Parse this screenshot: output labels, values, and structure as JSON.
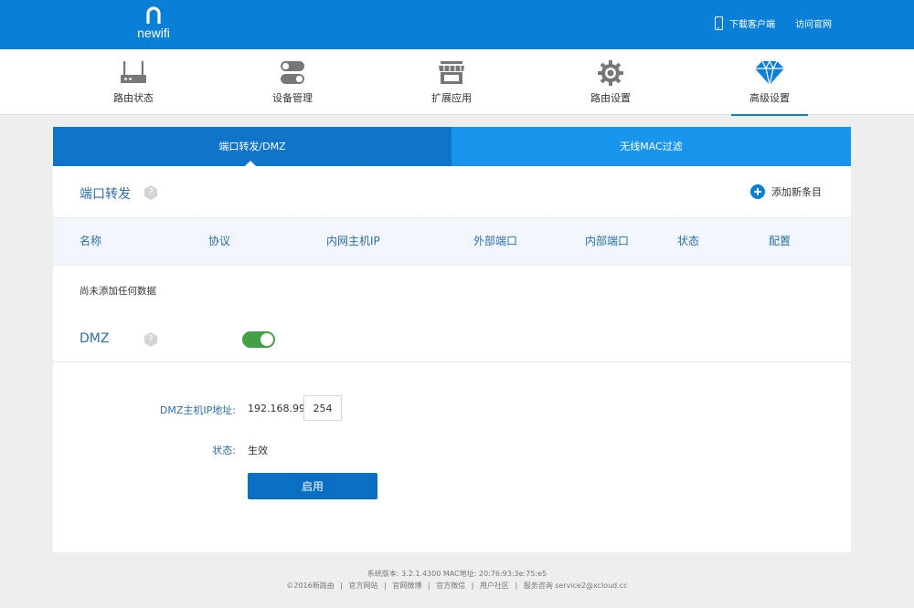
{
  "header": {
    "brand": "newifi",
    "links": [
      "下载客户端",
      "访问官网"
    ]
  },
  "nav": {
    "items": [
      {
        "label": "路由状态",
        "icon": "router-icon"
      },
      {
        "label": "设备管理",
        "icon": "toggle-switches-icon"
      },
      {
        "label": "扩展应用",
        "icon": "store-icon"
      },
      {
        "label": "路由设置",
        "icon": "gear-icon"
      },
      {
        "label": "高级设置",
        "icon": "diamond-icon"
      }
    ],
    "active_index": 4
  },
  "tabs": [
    "端口转发/DMZ",
    "无线MAC过滤"
  ],
  "port_forward": {
    "title": "端口转发",
    "help": "?",
    "add_label": "添加新条目",
    "columns": [
      "名称",
      "协议",
      "内网主机IP",
      "外部端口",
      "内部端口",
      "状态",
      "配置"
    ],
    "empty_text": "尚未添加任何数据"
  },
  "dmz": {
    "title": "DMZ",
    "help": "?",
    "enabled": true,
    "host_ip_label": "DMZ主机IP地址:",
    "ip_prefix": "192.168.99.",
    "ip_last": "254",
    "status_label": "状态:",
    "status_value": "生效",
    "button_label": "启用"
  },
  "footer": {
    "version_line": "系统版本:   3.2.1.4300    MAC地址:   20:76:93:3e:75:e5",
    "links": [
      "©2016新路由",
      "|",
      "官方网站",
      "|",
      "官网微博",
      "|",
      "官方微信",
      "|",
      "用户社区",
      "|",
      "服务咨询 service2@xcloud.cc"
    ]
  },
  "colors": {
    "brand_blue": "#0a7fd8",
    "tab_active": "#0d74c8",
    "tab_inactive": "#1a95ee",
    "toggle_on": "#43a047"
  }
}
